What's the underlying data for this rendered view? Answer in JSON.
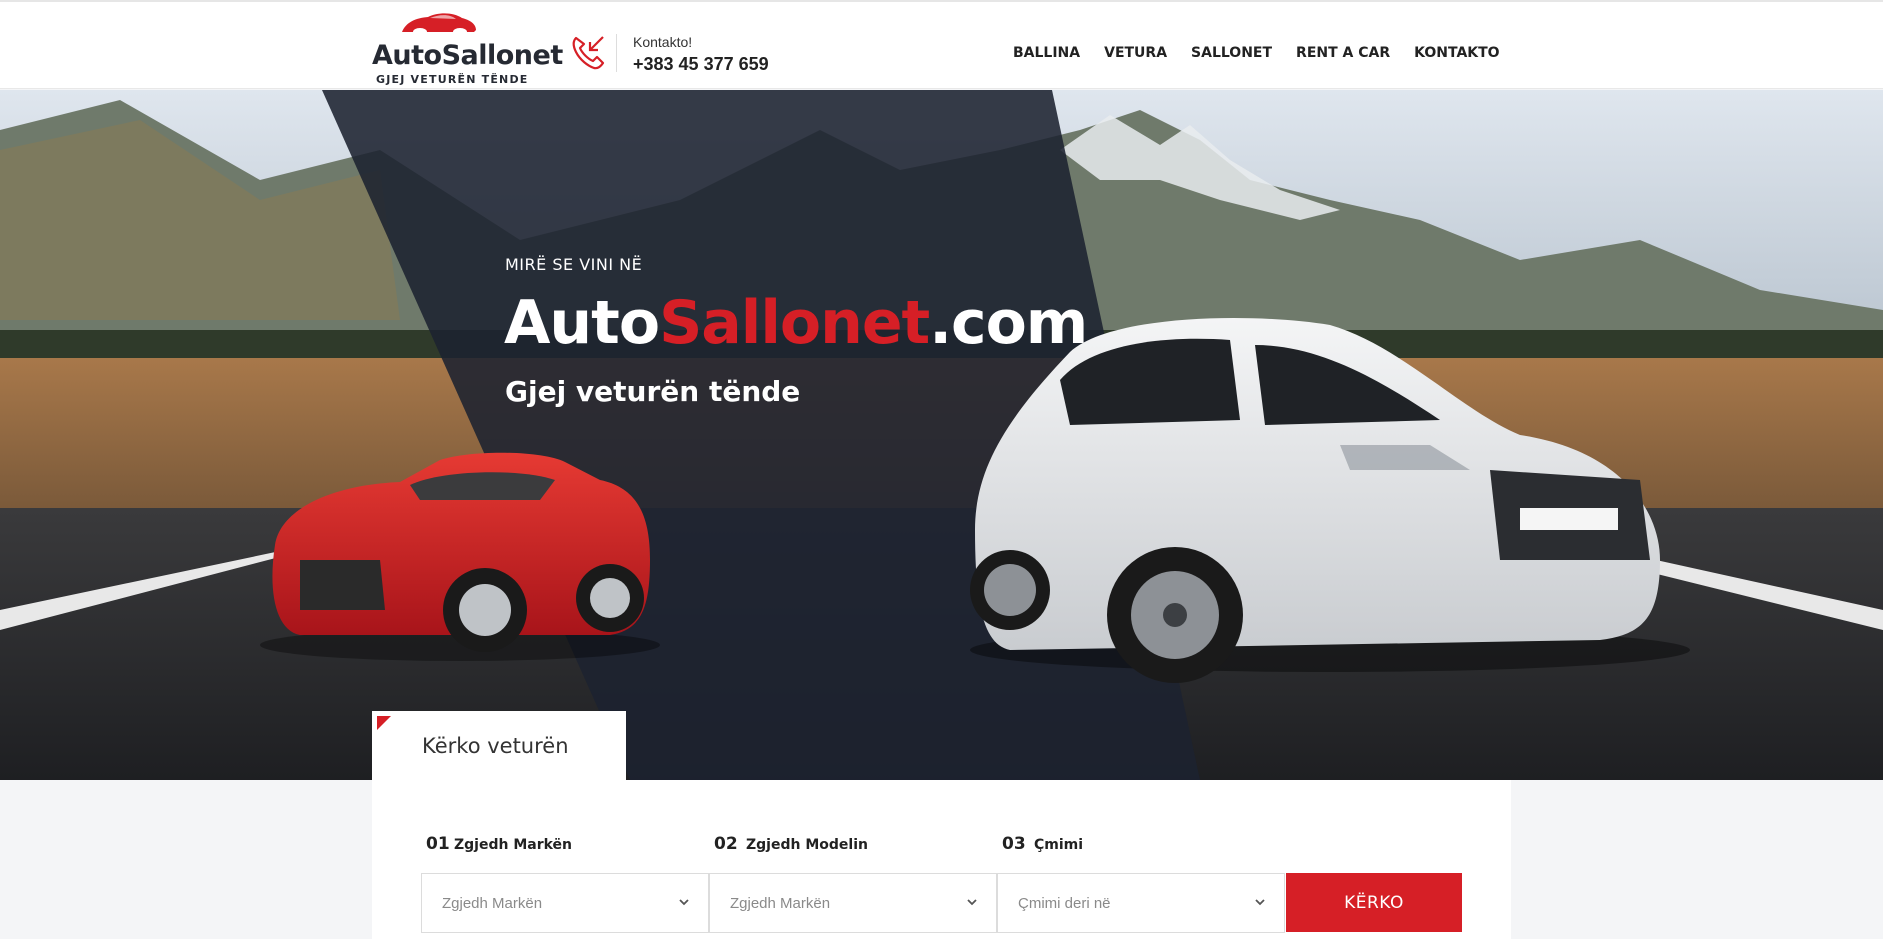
{
  "header": {
    "logo_name": "AutoSallonet",
    "logo_tagline": "GJEJ VETURËN TËNDE",
    "contact_label": "Kontakto!",
    "contact_phone": "+383 45 377 659",
    "nav": [
      "BALLINA",
      "VETURA",
      "SALLONET",
      "RENT A CAR",
      "KONTAKTO"
    ]
  },
  "hero": {
    "kicker": "MIRË SE VINI NË",
    "title_part1": "Auto",
    "title_part2": "Sallonet",
    "title_part3": ".com",
    "subtitle": "Gjej veturën tënde"
  },
  "search": {
    "tab_label": "Kërko veturën",
    "fields": [
      {
        "num": "01",
        "label": "Zgjedh Markën",
        "value": "Zgjedh Markën"
      },
      {
        "num": "02",
        "label": "Zgjedh Modelin",
        "value": "Zgjedh Markën"
      },
      {
        "num": "03",
        "label": "Çmimi",
        "value": "Çmimi deri në"
      }
    ],
    "button_label": "KËRKO"
  },
  "colors": {
    "accent": "#d61f26",
    "dark": "#262a33"
  }
}
